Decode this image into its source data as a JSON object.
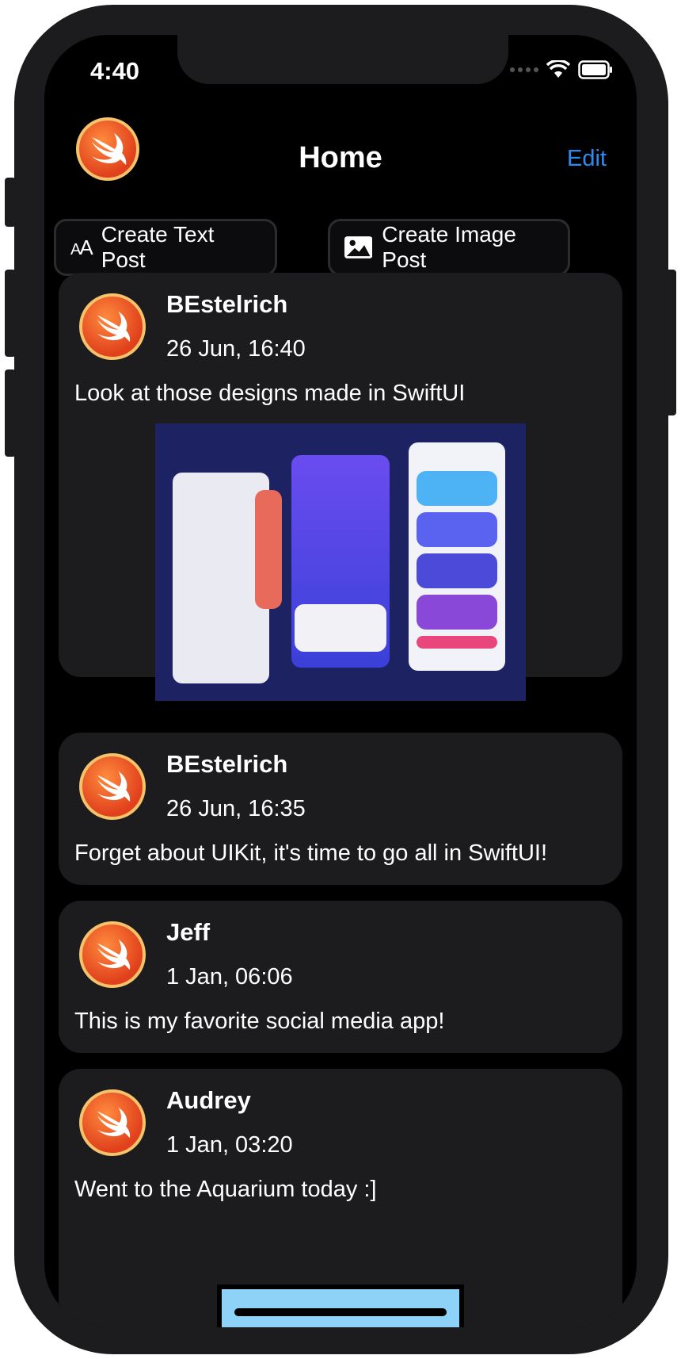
{
  "status": {
    "time": "4:40"
  },
  "nav": {
    "title": "Home",
    "edit_label": "Edit"
  },
  "actions": {
    "text_post_label": "Create Text Post",
    "image_post_label": "Create Image Post"
  },
  "posts": [
    {
      "author": "BEstelrich",
      "date": "26 Jun, 16:40",
      "text": "Look at those designs made in SwiftUI",
      "has_image": true
    },
    {
      "author": "BEstelrich",
      "date": "26 Jun, 16:35",
      "text": "Forget about UIKit, it's time to go all in SwiftUI!"
    },
    {
      "author": "Jeff",
      "date": "1 Jan, 06:06",
      "text": "This is my favorite social media app!"
    },
    {
      "author": "Audrey",
      "date": "1 Jan, 03:20",
      "text": "Went to the Aquarium today :]"
    }
  ],
  "colors": {
    "accent": "#2a8cf2",
    "card": "#1c1c1e",
    "background": "#000000"
  }
}
